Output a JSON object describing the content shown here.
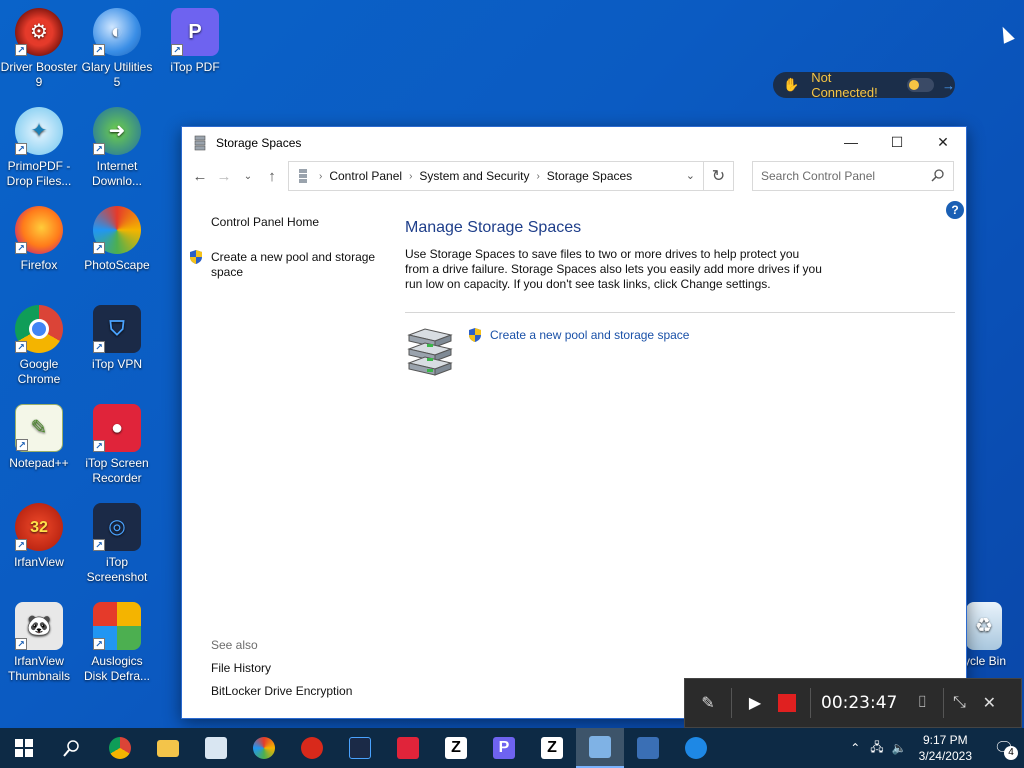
{
  "desktop": {
    "icons": [
      {
        "label": "Driver Booster 9",
        "icon": "driver-booster-icon"
      },
      {
        "label": "Glary Utilities 5",
        "icon": "glary-utilities-icon"
      },
      {
        "label": "iTop PDF",
        "icon": "itop-pdf-icon"
      },
      {
        "label": "PrimoPDF - Drop Files...",
        "icon": "primopdf-icon"
      },
      {
        "label": "Internet Downlo...",
        "icon": "internet-download-manager-icon"
      },
      {
        "label": "Firefox",
        "icon": "firefox-icon"
      },
      {
        "label": "PhotoScape",
        "icon": "photoscape-icon"
      },
      {
        "label": "Google Chrome",
        "icon": "chrome-icon"
      },
      {
        "label": "iTop VPN",
        "icon": "itop-vpn-icon"
      },
      {
        "label": "Notepad++",
        "icon": "notepadpp-icon"
      },
      {
        "label": "iTop Screen Recorder",
        "icon": "itop-screen-recorder-icon"
      },
      {
        "label": "IrfanView",
        "icon": "irfanview-icon"
      },
      {
        "label": "iTop Screenshot",
        "icon": "itop-screenshot-icon"
      },
      {
        "label": "IrfanView Thumbnails",
        "icon": "irfanview-thumbnails-icon"
      },
      {
        "label": "Auslogics Disk Defra...",
        "icon": "auslogics-icon"
      },
      {
        "label": "cycle Bin",
        "icon": "recycle-bin-icon"
      }
    ]
  },
  "vpn_widget": {
    "status": "Not Connected!"
  },
  "window": {
    "title": "Storage Spaces",
    "address": {
      "crumbs": [
        "Control Panel",
        "System and Security",
        "Storage Spaces"
      ]
    },
    "search": {
      "placeholder": "Search Control Panel"
    },
    "left_pane": {
      "home": "Control Panel Home",
      "create_link": "Create a new pool and storage space",
      "see_also_heading": "See also",
      "see_also": [
        "File History",
        "BitLocker Drive Encryption"
      ]
    },
    "main": {
      "heading": "Manage Storage Spaces",
      "description": "Use Storage Spaces to save files to two or more drives to help protect you from a drive failure. Storage Spaces also lets you easily add more drives if you run low on capacity. If you don't see task links, click Change settings.",
      "task_link": "Create a new pool and storage space"
    }
  },
  "recorder": {
    "elapsed": "00:23:47"
  },
  "taskbar": {
    "time": "9:17 PM",
    "date": "3/24/2023",
    "notifications": "4"
  },
  "colors": {
    "desktop": "#0b5bc2",
    "link": "#1a51a8",
    "heading": "#1e3e8a",
    "taskbar": "#0d2a45",
    "record_red": "#e02020"
  }
}
